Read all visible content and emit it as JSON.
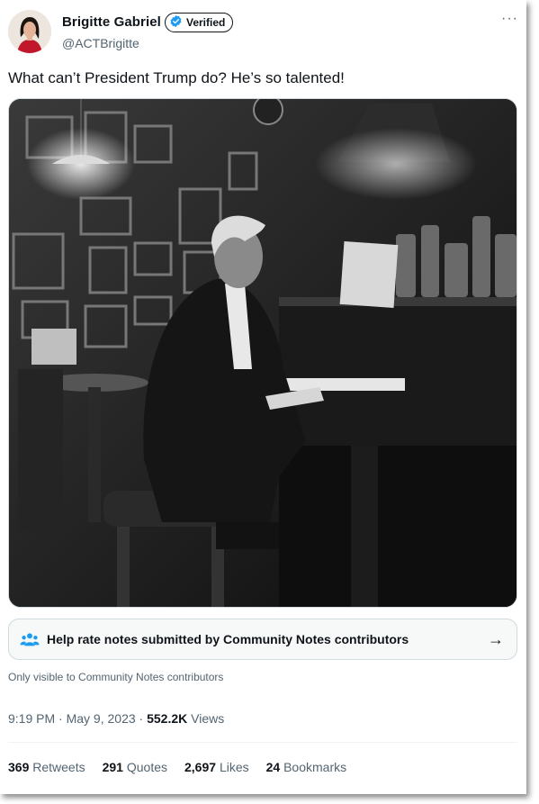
{
  "author": {
    "name": "Brigitte Gabriel",
    "verified_label": "Verified",
    "handle": "@ACTBrigitte"
  },
  "more_icon": "···",
  "tweet": {
    "text": "What can’t President Trump do? He’s so talented!"
  },
  "community_notes": {
    "prompt": "Help rate notes submitted by Community Notes contributors",
    "visibility": "Only visible to Community Notes contributors",
    "arrow": "→"
  },
  "meta": {
    "time": "9:19 PM",
    "date": "May 9, 2023",
    "views_count": "552.2K",
    "views_label": "Views"
  },
  "stats": {
    "retweets_count": "369",
    "retweets_label": "Retweets",
    "quotes_count": "291",
    "quotes_label": "Quotes",
    "likes_count": "2,697",
    "likes_label": "Likes",
    "bookmarks_count": "24",
    "bookmarks_label": "Bookmarks"
  },
  "colors": {
    "verified_blue": "#1d9bf0",
    "text_primary": "#0f1419",
    "text_secondary": "#536471"
  }
}
